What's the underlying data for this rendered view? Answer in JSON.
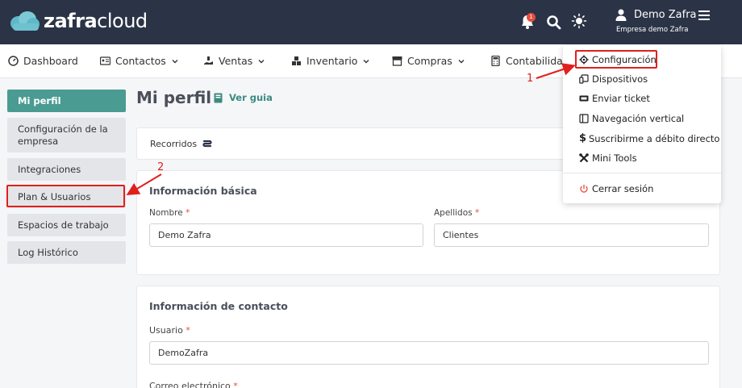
{
  "app": {
    "logo_bold": "zafra",
    "logo_light": "cloud",
    "notification_count": "1",
    "user_name": "Demo Zafra",
    "company_name": "Empresa demo Zafra"
  },
  "nav": [
    {
      "label": "Dashboard",
      "icon": "dashboard-icon"
    },
    {
      "label": "Contactos",
      "icon": "contacts-icon"
    },
    {
      "label": "Ventas",
      "icon": "sales-icon"
    },
    {
      "label": "Inventario",
      "icon": "inventory-icon"
    },
    {
      "label": "Compras",
      "icon": "store-icon"
    },
    {
      "label": "Contabilidad",
      "icon": "calculator-icon"
    }
  ],
  "sidebar": {
    "items": [
      {
        "label": "Mi perfil"
      },
      {
        "label": "Configuración de la empresa"
      },
      {
        "label": "Integraciones"
      },
      {
        "label": "Plan & Usuarios"
      },
      {
        "label": "Espacios de trabajo"
      },
      {
        "label": "Log Histórico"
      }
    ]
  },
  "page": {
    "title": "Mi perfil",
    "guide_link": "Ver guia",
    "recorridos": "Recorridos"
  },
  "basic_info": {
    "heading": "Información básica",
    "name_label": "Nombre",
    "name_value": "Demo Zafra",
    "surname_label": "Apellidos",
    "surname_value": "Clientes"
  },
  "contact_info": {
    "heading": "Información de contacto",
    "user_label": "Usuario",
    "user_value": "DemoZafra",
    "email_label": "Correo electrónico"
  },
  "required_mark": "*",
  "dropdown": {
    "items": [
      {
        "label": "Configuración",
        "icon": "gear-icon"
      },
      {
        "label": "Dispositivos",
        "icon": "devices-icon"
      },
      {
        "label": "Enviar ticket",
        "icon": "ticket-icon"
      },
      {
        "label": "Navegación vertical",
        "icon": "layout-icon"
      },
      {
        "label": "Suscribirme a débito directo",
        "icon": "dollar-icon"
      },
      {
        "label": "Mini Tools",
        "icon": "tools-icon"
      }
    ],
    "logout": "Cerrar sesión"
  },
  "annotations": {
    "step1": "1",
    "step2": "2",
    "color": "#e0201c"
  },
  "colors": {
    "topbar": "#2b3346",
    "accent": "#4a9b91"
  }
}
